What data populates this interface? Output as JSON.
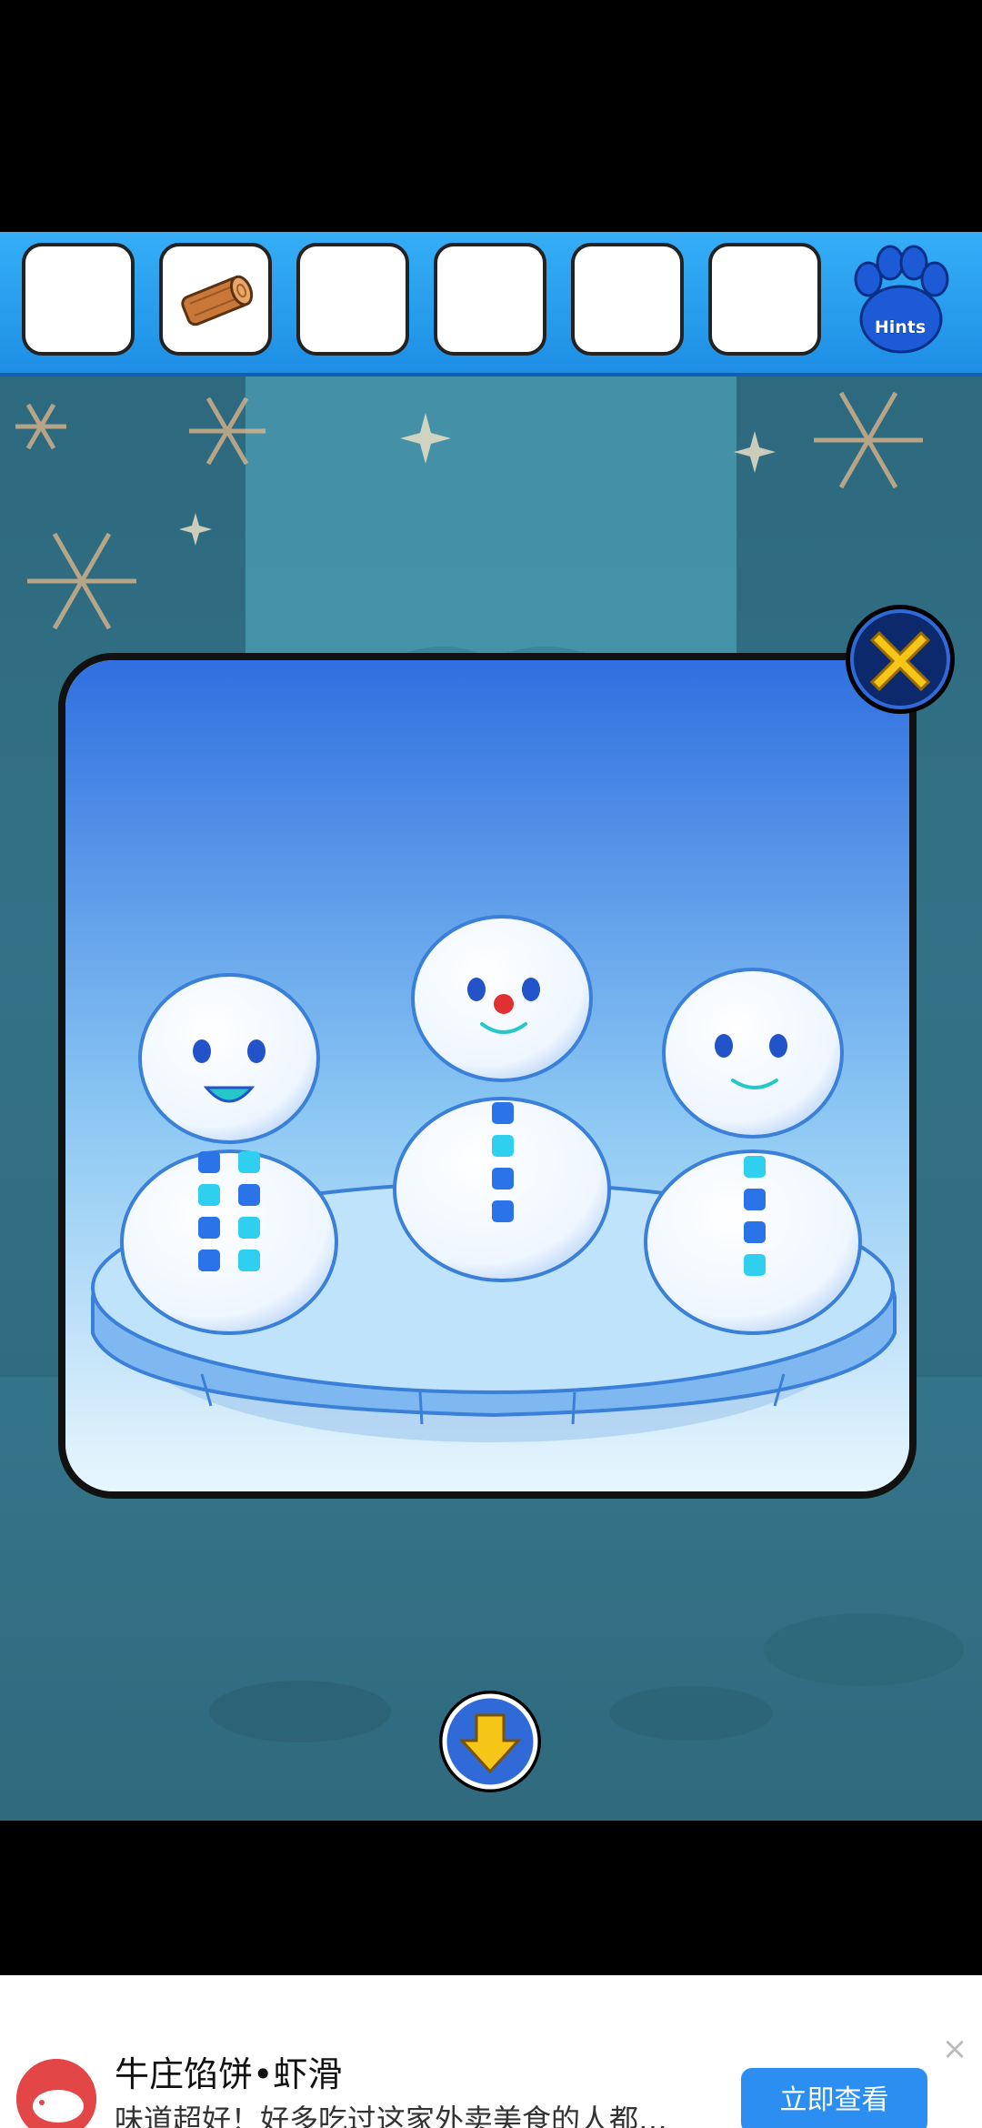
{
  "inventory": {
    "slots": [
      {
        "item": ""
      },
      {
        "item": "wooden-log"
      },
      {
        "item": ""
      },
      {
        "item": ""
      },
      {
        "item": ""
      },
      {
        "item": ""
      }
    ],
    "hints_label": "Hints"
  },
  "colors": {
    "inventory_bar": "#2aa3f2",
    "scene_bg": "#3a7f97",
    "button_gold": "#f5c518",
    "button_navy": "#0c2a6b",
    "ad_button": "#2b8ef0"
  },
  "scene": {
    "snowmen": [
      {
        "name": "left",
        "face": "open-smile",
        "buttons": [
          "blue",
          "cyan",
          "cyan",
          "blue",
          "blue",
          "cyan",
          "blue",
          "cyan"
        ]
      },
      {
        "name": "middle",
        "face": "red-nose-smile",
        "buttons": [
          "blue",
          "cyan",
          "blue",
          "blue"
        ]
      },
      {
        "name": "right",
        "face": "smile",
        "buttons": [
          "cyan",
          "blue",
          "blue",
          "cyan"
        ]
      }
    ]
  },
  "ad": {
    "title": "牛庄馅饼•虾滑",
    "description": "味道超好！好多吃过这家外卖美食的人都…",
    "cta": "立即查看",
    "close_glyph": "×"
  }
}
